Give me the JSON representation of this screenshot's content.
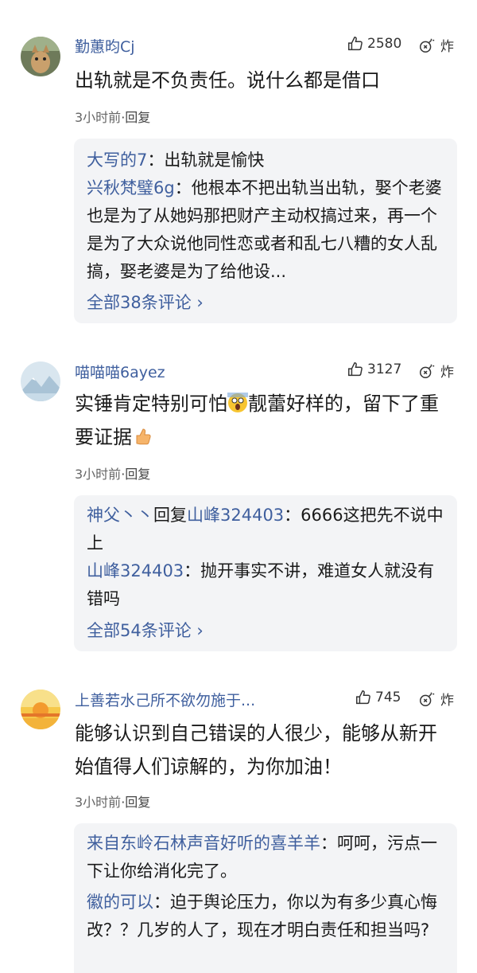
{
  "comments": [
    {
      "username": "勤蕙昀Cj",
      "likes": "2580",
      "boom_label": "炸",
      "text": "出轨就是不负责任。说什么都是借口",
      "time": "3小时前",
      "reply_label": "·回复",
      "replies": [
        {
          "name": "大写的7",
          "text": "：出轨就是愉快"
        },
        {
          "name": "兴秋梵璧6g",
          "text": "：他根本不把出轨当出轨，娶个老婆也是为了从她妈那把财产主动权搞过来，再一个是为了大众说他同性恋或者和乱七八糟的女人乱搞，娶老婆是为了给他设..."
        }
      ],
      "more": "全部38条评论 ›"
    },
    {
      "username": "喵喵喵6ayez",
      "likes": "3127",
      "boom_label": "炸",
      "text_part1": "实锤肯定特别可怕",
      "text_part2": "靓蕾好样的，留下了重要证据",
      "time": "3小时前",
      "reply_label": "·回复",
      "replies": [
        {
          "name": "神父丶丶",
          "mid": "回复",
          "name2": "山峰324403",
          "text": "：6666这把先不说中上"
        },
        {
          "name": "山峰324403",
          "text": "：抛开事实不讲，难道女人就没有错吗"
        }
      ],
      "more": "全部54条评论 ›"
    },
    {
      "username": "上善若水己所不欲勿施于...",
      "likes": "745",
      "boom_label": "炸",
      "text": "能够认识到自己错误的人很少，能够从新开始值得人们谅解的，为你加油！",
      "time": "3小时前",
      "reply_label": "·回复",
      "replies": [
        {
          "name": "来自东岭石林声音好听的喜羊羊",
          "text": "：呵呵，污点一下让你给消化完了。"
        },
        {
          "name": "徽的可以",
          "text": "：迫于舆论压力，你以为有多少真心悔改？？几岁的人了，现在才明白责任和担当吗?"
        }
      ]
    }
  ],
  "colors": {
    "link": "#3f5f9e",
    "reply_bg": "#f3f4f6",
    "meta": "#888888"
  }
}
